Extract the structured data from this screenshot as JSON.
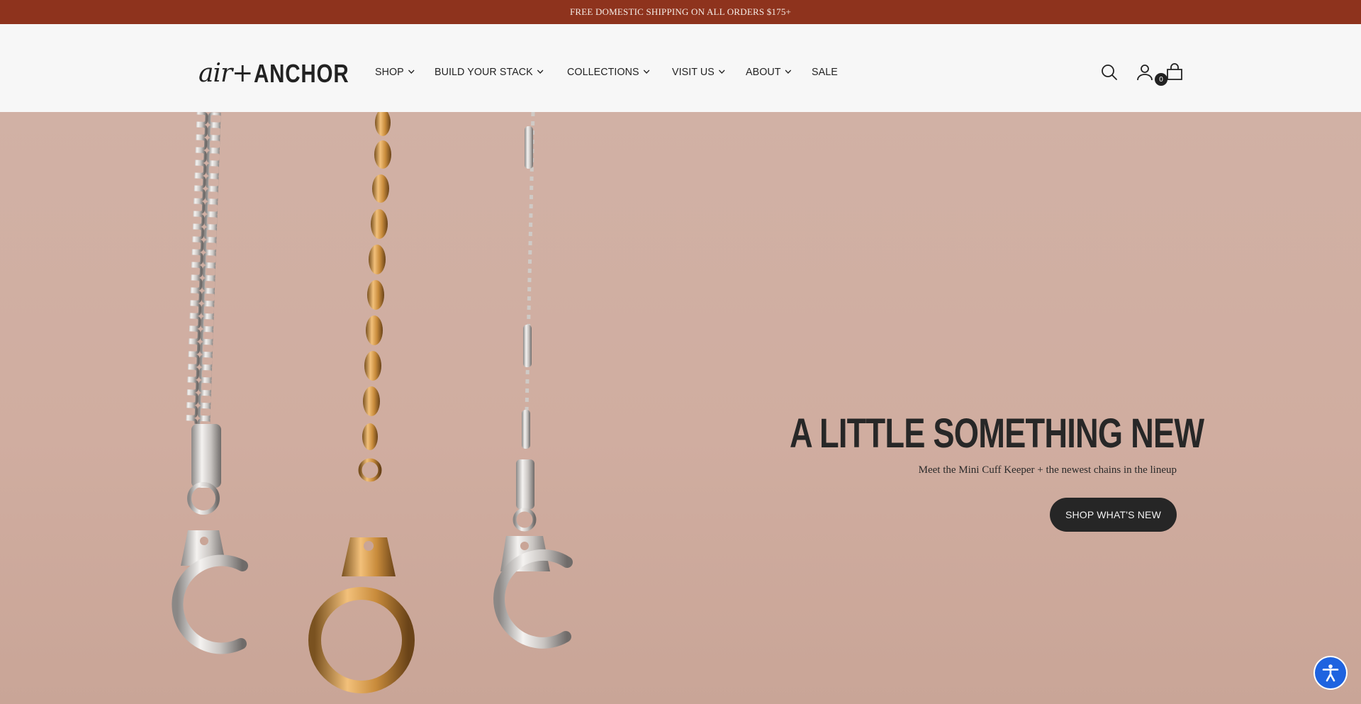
{
  "announcement": {
    "text": "FREE DOMESTIC SHIPPING ON ALL ORDERS $175+"
  },
  "header": {
    "logo": {
      "script": "air+",
      "block": "ANCHOR"
    },
    "nav": [
      {
        "label": "SHOP",
        "has_dropdown": true
      },
      {
        "label": "BUILD YOUR STACK",
        "has_dropdown": true
      },
      {
        "label": "COLLECTIONS",
        "has_dropdown": true
      },
      {
        "label": "VISIT US",
        "has_dropdown": true
      },
      {
        "label": "ABOUT",
        "has_dropdown": true
      },
      {
        "label": "SALE",
        "has_dropdown": false
      }
    ],
    "icons": [
      "search-icon",
      "account-icon",
      "cart-icon"
    ],
    "cart_count": "0"
  },
  "hero": {
    "title": "A LITTLE SOMETHING NEW",
    "subtitle": "Meet the Mini Cuff Keeper + the newest chains in the lineup",
    "button_label": "SHOP WHAT'S NEW"
  },
  "colors": {
    "announcement_bg": "#8e331d",
    "hero_bg": "#d1b1a5",
    "button_bg": "#262626",
    "accessibility_blue": "#1e63e0"
  },
  "accessibility": {
    "icon": "accessibility-icon"
  }
}
